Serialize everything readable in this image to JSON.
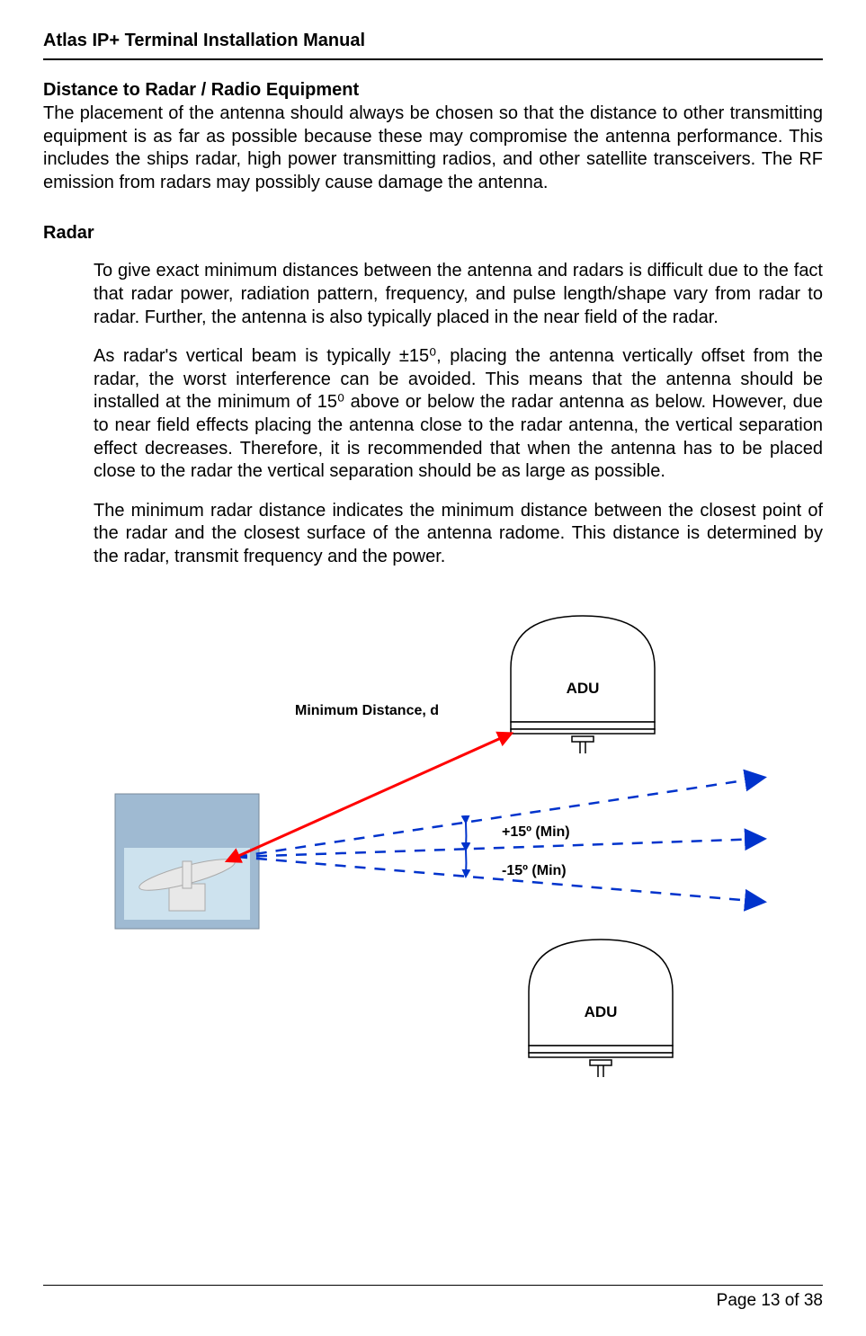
{
  "header": "Atlas IP+ Terminal Installation Manual",
  "section1": {
    "title": "Distance to Radar / Radio Equipment",
    "p1": "The placement of the antenna should always be chosen so that the distance to other transmitting equipment is as far as possible because these may compromise the antenna performance. This includes the ships radar, high power transmitting radios, and other satellite transceivers. The RF emission from radars may possibly cause damage the antenna."
  },
  "section2": {
    "title": "Radar",
    "p1": "To give exact minimum distances between the antenna and radars is difficult due to the fact that radar power, radiation pattern, frequency, and pulse length/shape vary from radar to radar. Further, the antenna is also typically placed in the near field of the radar.",
    "p2": "As radar's vertical beam is typically ±15⁰, placing the antenna vertically offset from the radar, the worst interference can be avoided. This means that the antenna should be installed at the minimum of 15⁰ above or below the radar antenna as below. However, due to near field effects placing the antenna close to the radar antenna, the vertical separation effect decreases. Therefore, it is recommended that when the antenna has to be placed close to the radar the vertical separation should be as large as possible.",
    "p3": "The minimum radar distance indicates the minimum distance between the closest point of the radar and the closest surface of the antenna radome. This distance is determined by the radar, transmit frequency and the power."
  },
  "diagram": {
    "min_distance_label": "Minimum Distance, d",
    "adu_label_top": "ADU",
    "adu_label_bottom": "ADU",
    "angle_upper": "+15º (Min)",
    "angle_lower": "-15º (Min)"
  },
  "footer": "Page 13 of 38"
}
